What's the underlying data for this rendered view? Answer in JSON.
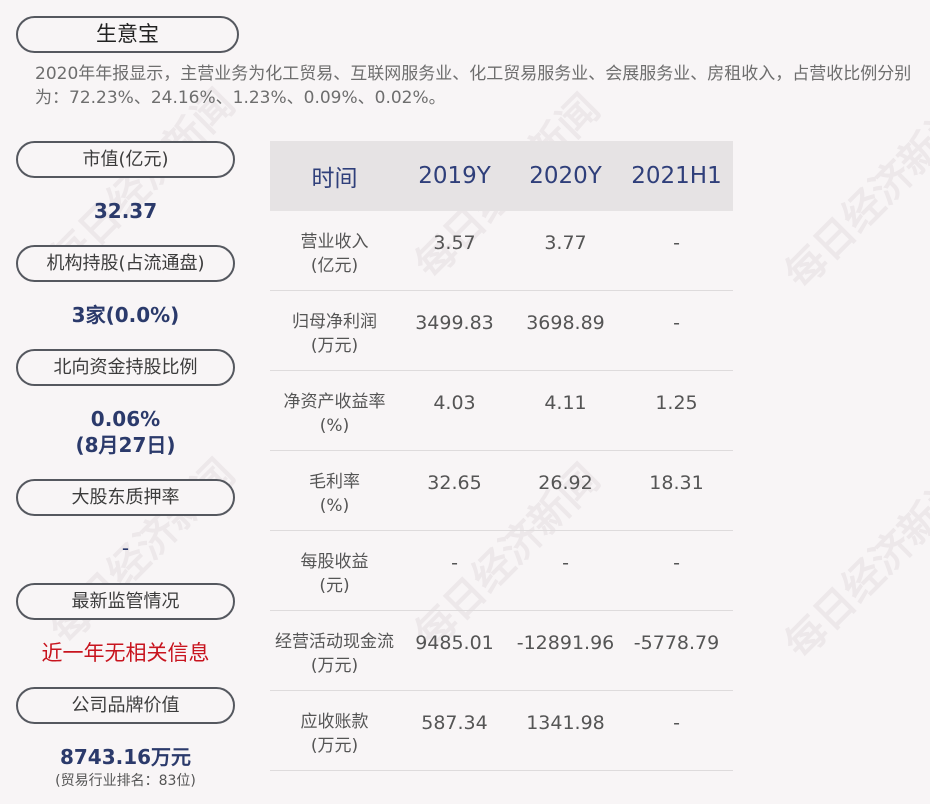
{
  "title": "生意宝",
  "summary": "2020年年报显示，主营业务为化工贸易、互联网服务业、化工贸易服务业、会展服务业、房租收入，占营收比例分别为：72.23%、24.16%、1.23%、0.09%、0.02%。",
  "watermark": "每日经济新闻",
  "left": {
    "market_cap_label": "市值(亿元)",
    "market_cap_value": "32.37",
    "institution_label": "机构持股(占流通盘)",
    "institution_value": "3家(0.0%)",
    "northbound_label": "北向资金持股比例",
    "northbound_value": "0.06%",
    "northbound_date": "(8月27日)",
    "pledge_label": "大股东质押率",
    "pledge_value": "-",
    "regulation_label": "最新监管情况",
    "regulation_value": "近一年无相关信息",
    "brand_label": "公司品牌价值",
    "brand_value": "8743.16万元",
    "brand_rank": "(贸易行业排名：83位)"
  },
  "table": {
    "headers": [
      "时间",
      "2019Y",
      "2020Y",
      "2021H1"
    ],
    "rows": [
      {
        "name": "营业收入",
        "unit": "(亿元)",
        "values": [
          "3.57",
          "3.77",
          "-"
        ]
      },
      {
        "name": "归母净利润",
        "unit": "(万元)",
        "values": [
          "3499.83",
          "3698.89",
          "-"
        ]
      },
      {
        "name": "净资产收益率",
        "unit": "(%)",
        "values": [
          "4.03",
          "4.11",
          "1.25"
        ]
      },
      {
        "name": "毛利率",
        "unit": "(%)",
        "values": [
          "32.65",
          "26.92",
          "18.31"
        ]
      },
      {
        "name": "每股收益",
        "unit": "(元)",
        "values": [
          "-",
          "-",
          "-"
        ]
      },
      {
        "name": "经营活动现金流",
        "unit": "(万元)",
        "values": [
          "9485.01",
          "-12891.96",
          "-5778.79"
        ]
      },
      {
        "name": "应收账款",
        "unit": "(万元)",
        "values": [
          "587.34",
          "1341.98",
          "-"
        ]
      }
    ]
  }
}
